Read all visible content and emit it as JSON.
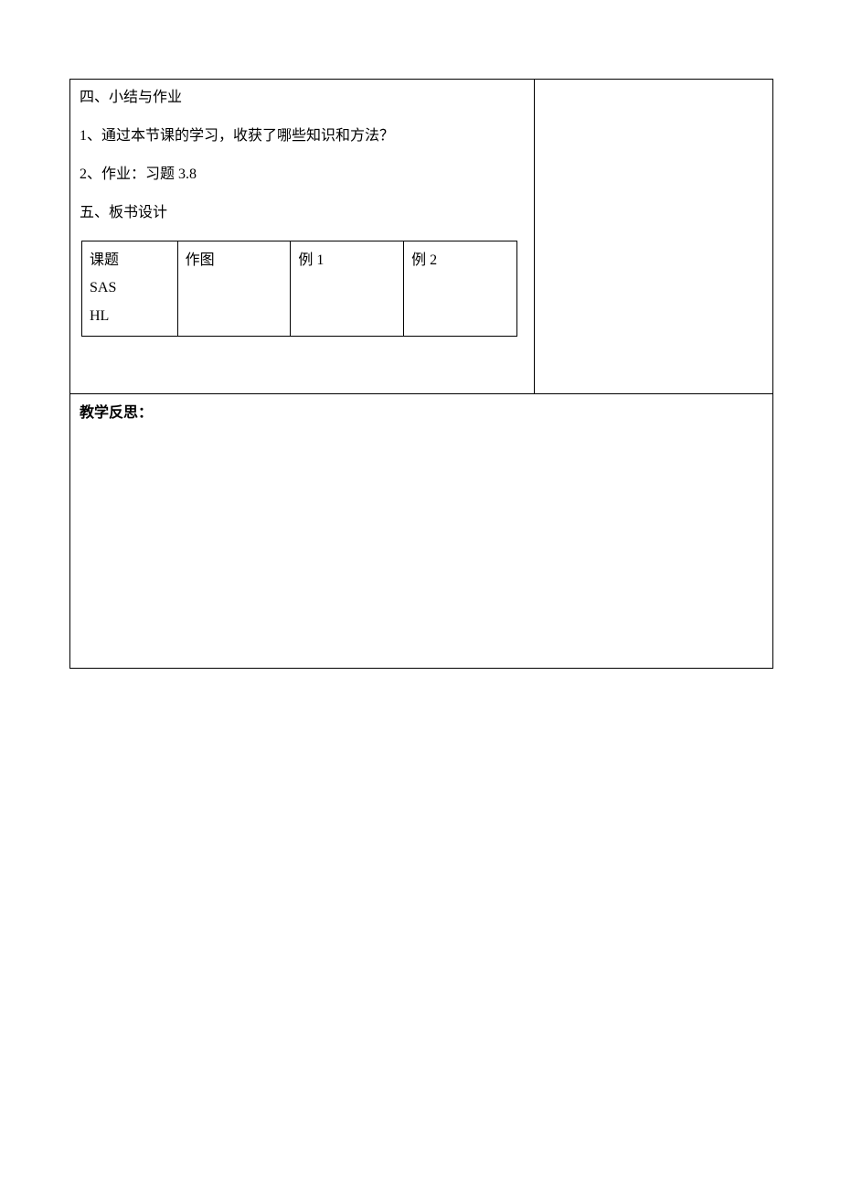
{
  "section4": {
    "title": "四、小结与作业",
    "item1": "1、通过本节课的学习，收获了哪些知识和方法？",
    "item2": "2、作业：习题 3.8"
  },
  "section5": {
    "title": "五、板书设计",
    "table": {
      "col1_line1": "课题",
      "col1_line2": "SAS",
      "col1_line3": "HL",
      "col2": "作图",
      "col3": "例 1",
      "col4": "例 2"
    }
  },
  "reflection": {
    "label": "教学反思："
  }
}
